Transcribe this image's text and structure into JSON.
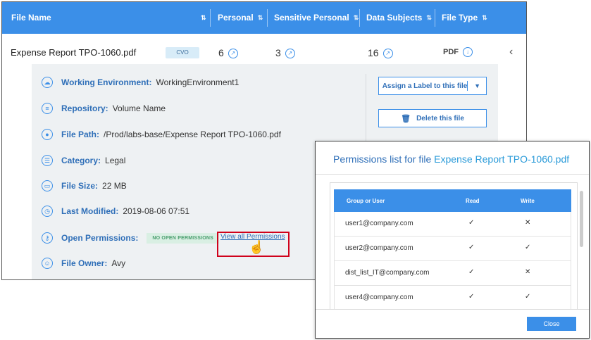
{
  "header": {
    "columns": [
      "File Name",
      "Personal",
      "Sensitive Personal",
      "Data Subjects",
      "File Type"
    ],
    "sort_icon": "sort-arrows-icon"
  },
  "file_row": {
    "name": "Expense Report TPO-1060.pdf",
    "badge": "CVO",
    "personal": "6",
    "sensitive_personal": "3",
    "data_subjects": "16",
    "file_type": "PDF",
    "collapse_icon": "chevron-left-icon"
  },
  "details": {
    "working_environment": {
      "label": "Working Environment:",
      "value": "WorkingEnvironment1",
      "icon": "cloud-icon"
    },
    "repository": {
      "label": "Repository:",
      "value": "Volume Name",
      "icon": "database-icon"
    },
    "file_path": {
      "label": "File Path:",
      "value": "/Prod/labs-base/Expense Report TPO-1060.pdf",
      "icon": "location-pin-icon"
    },
    "category": {
      "label": "Category:",
      "value": "Legal",
      "icon": "list-icon"
    },
    "file_size": {
      "label": "File Size:",
      "value": "22 MB",
      "icon": "folder-icon"
    },
    "last_modified": {
      "label": "Last Modified:",
      "value": "2019-08-06 07:51",
      "icon": "clock-icon"
    },
    "open_permissions": {
      "label": "Open Permissions:",
      "badge": "NO OPEN PERMISSIONS",
      "link": "View all Permissions",
      "icon": "key-icon"
    },
    "file_owner": {
      "label": "File Owner:",
      "value": "Avy",
      "icon": "user-card-icon"
    }
  },
  "actions": {
    "assign_label": "Assign a Label to this file",
    "delete_file": "Delete this file"
  },
  "dialog": {
    "title_prefix": "Permissions list for file",
    "file_name": "Expense Report TPO-1060.pdf",
    "columns": [
      "Group or User",
      "Read",
      "Write"
    ],
    "rows": [
      {
        "user": "user1@company.com",
        "read": "✓",
        "write": "✕"
      },
      {
        "user": "user2@company.com",
        "read": "✓",
        "write": "✓"
      },
      {
        "user": "dist_list_IT@company.com",
        "read": "✓",
        "write": "✕"
      },
      {
        "user": "user4@company.com",
        "read": "✓",
        "write": "✓"
      }
    ],
    "close_label": "Close"
  },
  "colors": {
    "accent": "#3b8fe8",
    "highlight_border": "#d0021b",
    "no_open_badge_bg": "#d9efe3"
  }
}
